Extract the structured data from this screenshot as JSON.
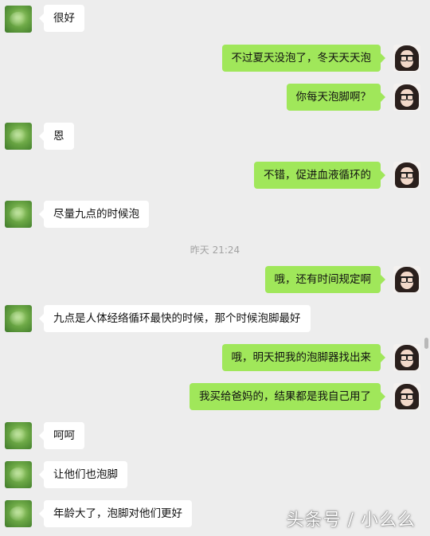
{
  "chat": {
    "timestamp": "昨天 21:24",
    "messages": [
      {
        "side": "left",
        "text": "很好"
      },
      {
        "side": "right",
        "text": "不过夏天没泡了，冬天天天泡"
      },
      {
        "side": "right",
        "text": "你每天泡脚啊？"
      },
      {
        "side": "left",
        "text": "恩"
      },
      {
        "side": "right",
        "text": "不错，促进血液循环的"
      },
      {
        "side": "left",
        "text": "尽量九点的时候泡"
      },
      {
        "side": "right",
        "text": "哦，还有时间规定啊"
      },
      {
        "side": "left",
        "text": "九点是人体经络循环最快的时候，那个时候泡脚最好"
      },
      {
        "side": "right",
        "text": "哦，明天把我的泡脚器找出来"
      },
      {
        "side": "right",
        "text": "我买给爸妈的，结果都是我自己用了"
      },
      {
        "side": "left",
        "text": "呵呵"
      },
      {
        "side": "left",
        "text": "让他们也泡脚"
      },
      {
        "side": "left",
        "text": "年龄大了，泡脚对他们更好"
      }
    ]
  },
  "watermark": "头条号 / 小么么",
  "colors": {
    "background": "#ededed",
    "bubble_self": "#a0e75a",
    "bubble_other": "#ffffff"
  }
}
